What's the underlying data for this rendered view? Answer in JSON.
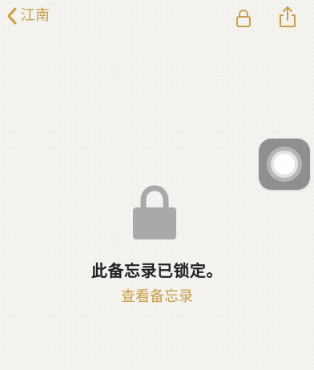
{
  "nav": {
    "back_label": "江南",
    "back_icon": "chevron-left-icon",
    "lock_icon": "lock-icon",
    "share_icon": "share-icon"
  },
  "content": {
    "locked_message": "此备忘录已锁定。",
    "view_note_label": "查看备忘录",
    "center_icon": "lock-icon"
  },
  "colors": {
    "accent": "#c9a04a",
    "background": "#f3f2ef",
    "text": "#222222",
    "lock_gray": "#a9a9a9",
    "assistive_bg": "#737373"
  }
}
